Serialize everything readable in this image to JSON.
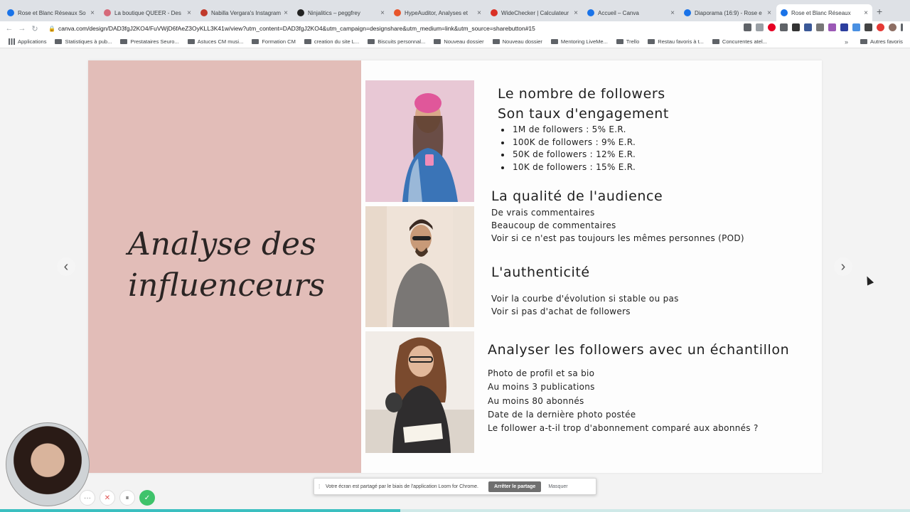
{
  "browser": {
    "tabs": [
      {
        "title": "Rose et Blanc Réseaux So",
        "color": "#1a73e8"
      },
      {
        "title": "La boutique QUEER - Des",
        "color": "#d66a7a"
      },
      {
        "title": "Nabilla Vergara's Instagram",
        "color": "#c0392b"
      },
      {
        "title": "Ninjalitics – peggfrey",
        "color": "#222222"
      },
      {
        "title": "HypeAuditor, Analyses et",
        "color": "#e8552b"
      },
      {
        "title": "WideChecker | Calculateur",
        "color": "#d93025"
      },
      {
        "title": "Accueil – Canva",
        "color": "#1a73e8"
      },
      {
        "title": "Diaporama (16:9) - Rose e",
        "color": "#1a73e8"
      },
      {
        "title": "Rose et Blanc Réseaux",
        "color": "#1a73e8"
      }
    ],
    "active_tab_index": 8,
    "new_tab": "+",
    "url": "canva.com/design/DAD3fgJ2KO4/FuVWjD6fAeZ3OyKLL3K41w/view?utm_content=DAD3fgJ2KO4&utm_campaign=designshare&utm_medium=link&utm_source=sharebutton#15",
    "bookmarks": [
      {
        "label": "Applications",
        "icon": "apps-grid-icon"
      },
      {
        "label": "Statistiques à pub...",
        "icon": "folder-icon"
      },
      {
        "label": "Prestataires Seuro...",
        "icon": "folder-icon"
      },
      {
        "label": "Astuces CM musi...",
        "icon": "folder-icon"
      },
      {
        "label": "Formation CM",
        "icon": "folder-icon"
      },
      {
        "label": "creation du site L...",
        "icon": "folder-icon"
      },
      {
        "label": "Biscuits personnal...",
        "icon": "folder-icon"
      },
      {
        "label": "Nouveau dossier",
        "icon": "folder-icon"
      },
      {
        "label": "Nouveau dossier",
        "icon": "folder-icon"
      },
      {
        "label": "Mentoring LiveMe...",
        "icon": "folder-icon"
      },
      {
        "label": "Trello",
        "icon": "folder-icon"
      },
      {
        "label": "Restau favoris à t...",
        "icon": "folder-icon"
      },
      {
        "label": "Concurentes atel...",
        "icon": "folder-icon"
      }
    ],
    "bookmarks_more": "»",
    "other_bookmarks": "Autres favoris"
  },
  "slide": {
    "title": "Analyse des\ninfluenceurs",
    "accent_color": "#e2bdb8",
    "section1": {
      "heading1": "Le nombre de followers",
      "heading2": "Son taux d'engagement",
      "bullets": [
        "1M de followers : 5% E.R.",
        "100K de followers : 9% E.R.",
        "50K de followers : 12% E.R.",
        "10K de followers : 15% E.R."
      ]
    },
    "section2": {
      "heading": "La qualité de l'audience",
      "lines": [
        "De vrais commentaires",
        "Beaucoup de commentaires",
        "Voir si ce n'est pas toujours les mêmes personnes (POD)"
      ]
    },
    "section3": {
      "heading": "L'authenticité",
      "lines": [
        "Voir la courbe d'évolution si stable ou pas",
        "Voir si pas d'achat de followers"
      ]
    },
    "section4": {
      "heading": "Analyser les followers avec un échantillon",
      "lines": [
        "Photo de profil et sa bio",
        "Au moins 3 publications",
        "Au moins 80 abonnés",
        "Date de la dernière photo postée",
        "Le follower a-t-il trop d'abonnement comparé aux abonnés ?"
      ]
    }
  },
  "nav": {
    "prev": "‹",
    "next": "›"
  },
  "share_bar": {
    "message": "Votre écran est partagé par le biais de l'application Loom for Chrome.",
    "stop_label": "Arrêter le partage",
    "hide_label": "Masquer"
  },
  "recording": {
    "progress_fraction": 0.44,
    "more": "···",
    "cancel": "✕",
    "pause": "⏸",
    "done": "✓"
  }
}
